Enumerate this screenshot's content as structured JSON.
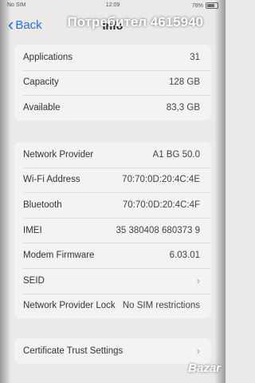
{
  "status_bar": {
    "carrier": "No SIM",
    "time": "12:09",
    "battery": "78%"
  },
  "nav": {
    "back_label": "Back",
    "title": "Info"
  },
  "watermark": "Потребител 4615940",
  "brand": "Bazar",
  "storage": [
    {
      "label": "Applications",
      "value": "31"
    },
    {
      "label": "Capacity",
      "value": "128 GB"
    },
    {
      "label": "Available",
      "value": "83,3 GB"
    }
  ],
  "network": [
    {
      "label": "Network Provider",
      "value": "A1 BG 50.0"
    },
    {
      "label": "Wi-Fi Address",
      "value": "70:70:0D:20:4C:4E"
    },
    {
      "label": "Bluetooth",
      "value": "70:70:0D:20:4C:4F"
    },
    {
      "label": "IMEI",
      "value": "35 380408 680373 9"
    },
    {
      "label": "Modem Firmware",
      "value": "6.03.01"
    },
    {
      "label": "SEID",
      "value": ""
    },
    {
      "label": "Network Provider Lock",
      "value": "No SIM restrictions"
    }
  ],
  "certs": {
    "label": "Certificate Trust Settings"
  }
}
